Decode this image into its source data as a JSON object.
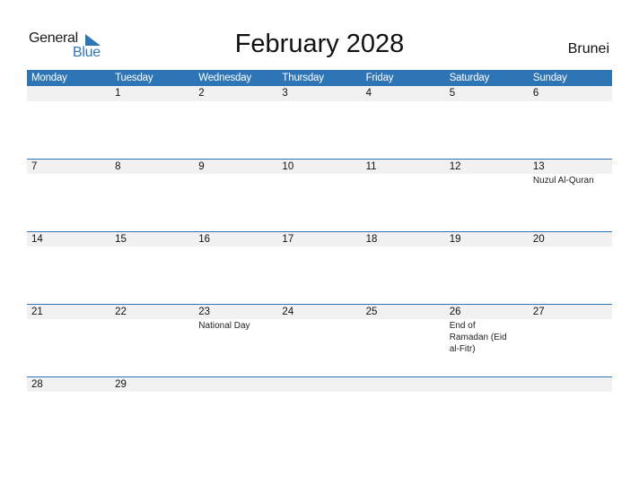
{
  "logo": {
    "text_general": "General",
    "text_blue": "Blue",
    "brand_color": "#2e75b6"
  },
  "title": "February 2028",
  "country": "Brunei",
  "weekdays": [
    "Monday",
    "Tuesday",
    "Wednesday",
    "Thursday",
    "Friday",
    "Saturday",
    "Sunday"
  ],
  "weeks": [
    {
      "days": [
        {
          "num": "",
          "event": ""
        },
        {
          "num": "1",
          "event": ""
        },
        {
          "num": "2",
          "event": ""
        },
        {
          "num": "3",
          "event": ""
        },
        {
          "num": "4",
          "event": ""
        },
        {
          "num": "5",
          "event": ""
        },
        {
          "num": "6",
          "event": ""
        }
      ]
    },
    {
      "days": [
        {
          "num": "7",
          "event": ""
        },
        {
          "num": "8",
          "event": ""
        },
        {
          "num": "9",
          "event": ""
        },
        {
          "num": "10",
          "event": ""
        },
        {
          "num": "11",
          "event": ""
        },
        {
          "num": "12",
          "event": ""
        },
        {
          "num": "13",
          "event": "Nuzul Al-Quran"
        }
      ]
    },
    {
      "days": [
        {
          "num": "14",
          "event": ""
        },
        {
          "num": "15",
          "event": ""
        },
        {
          "num": "16",
          "event": ""
        },
        {
          "num": "17",
          "event": ""
        },
        {
          "num": "18",
          "event": ""
        },
        {
          "num": "19",
          "event": ""
        },
        {
          "num": "20",
          "event": ""
        }
      ]
    },
    {
      "days": [
        {
          "num": "21",
          "event": ""
        },
        {
          "num": "22",
          "event": ""
        },
        {
          "num": "23",
          "event": "National Day"
        },
        {
          "num": "24",
          "event": ""
        },
        {
          "num": "25",
          "event": ""
        },
        {
          "num": "26",
          "event": "End of Ramadan (Eid al-Fitr)"
        },
        {
          "num": "27",
          "event": ""
        }
      ]
    },
    {
      "days": [
        {
          "num": "28",
          "event": ""
        },
        {
          "num": "29",
          "event": ""
        },
        {
          "num": "",
          "event": ""
        },
        {
          "num": "",
          "event": ""
        },
        {
          "num": "",
          "event": ""
        },
        {
          "num": "",
          "event": ""
        },
        {
          "num": "",
          "event": ""
        }
      ]
    }
  ]
}
